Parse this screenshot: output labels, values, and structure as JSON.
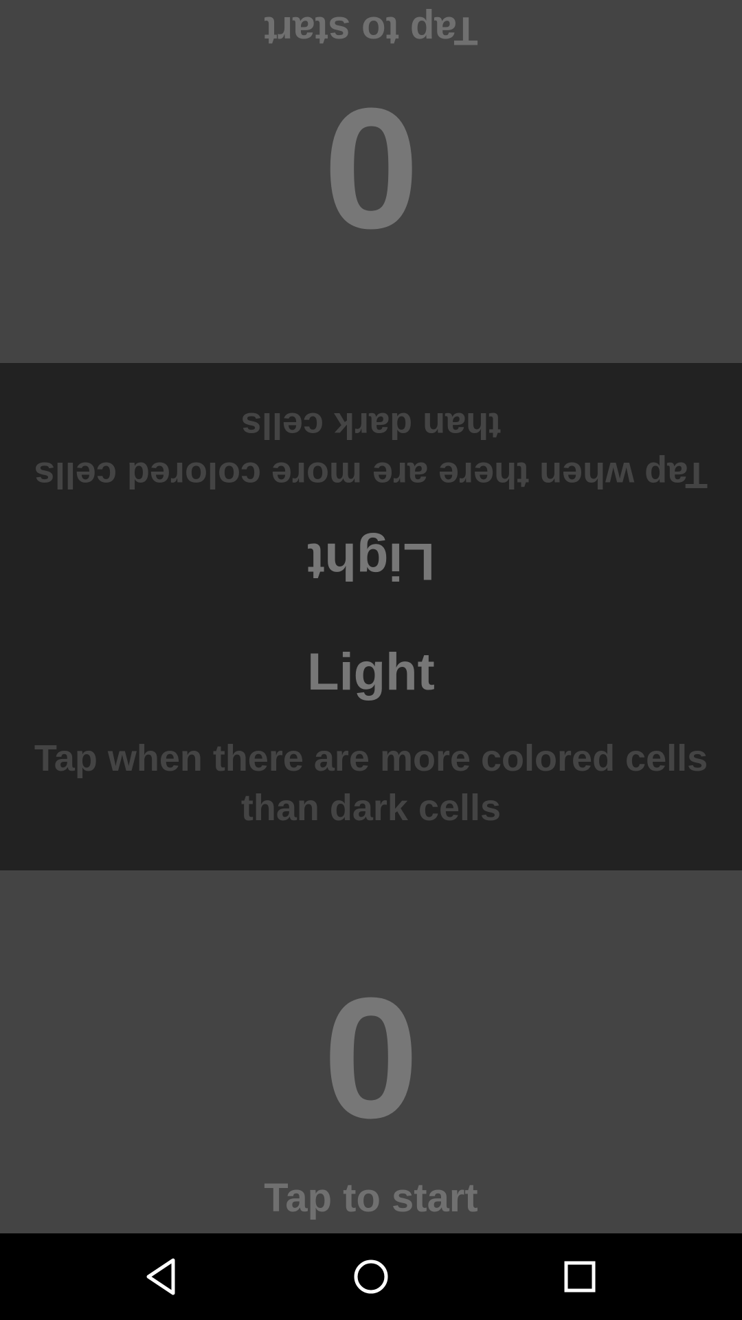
{
  "top_player": {
    "score": "0",
    "tap_to_start": "Tap to start"
  },
  "bottom_player": {
    "score": "0",
    "tap_to_start": "Tap to start"
  },
  "instruction": {
    "mode": "Light",
    "description": "Tap when there are more colored cells than dark cells"
  },
  "nav_bar": {
    "back_icon": "back-triangle",
    "home_icon": "home-circle",
    "recent_icon": "recent-square"
  },
  "colors": {
    "player_background": "#444444",
    "instruction_background": "#222222",
    "score_text": "#777777",
    "description_text": "#444444",
    "nav_background": "#000000",
    "nav_icon": "#ffffff"
  }
}
